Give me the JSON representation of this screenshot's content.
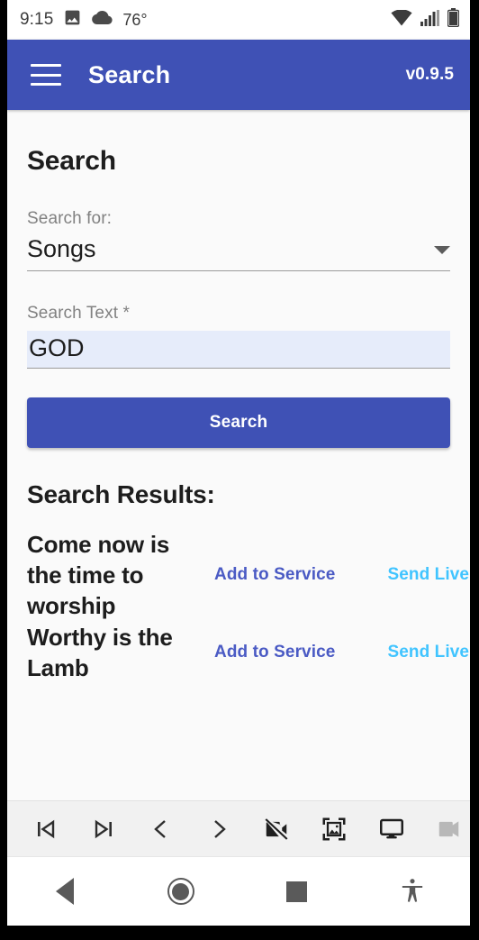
{
  "status_bar": {
    "time": "9:15",
    "temperature": "76°",
    "icons": [
      "image-icon",
      "cloud-icon",
      "wifi-icon",
      "cell-signal-icon",
      "battery-icon"
    ]
  },
  "app_bar": {
    "menu_icon": "hamburger-menu-icon",
    "title": "Search",
    "version": "v0.9.5",
    "background_color": "#3f51b5"
  },
  "main": {
    "page_title": "Search",
    "search_for": {
      "label": "Search for:",
      "value": "Songs",
      "caret_icon": "chevron-down-icon"
    },
    "search_text": {
      "label": "Search Text *",
      "value": "GOD",
      "placeholder": "",
      "highlight_color": "#e6ecfa"
    },
    "search_button": {
      "label": "Search",
      "color": "#3f51b5"
    },
    "results_title": "Search Results:",
    "results": [
      {
        "name": "Come now is the time to worship",
        "add_label": "Add to Service",
        "live_label": "Send Live"
      },
      {
        "name": "Worthy is the Lamb",
        "add_label": "Add to Service",
        "live_label": "Send Live"
      }
    ],
    "action_colors": {
      "add_to_service": "#4a5ac4",
      "send_live": "#40c4ff"
    }
  },
  "media_toolbar": {
    "buttons": [
      {
        "name": "skip-to-first-icon",
        "enabled": true
      },
      {
        "name": "skip-to-last-icon",
        "enabled": true
      },
      {
        "name": "previous-chevron-icon",
        "enabled": true
      },
      {
        "name": "next-chevron-icon",
        "enabled": true
      },
      {
        "name": "videocam-off-icon",
        "enabled": true
      },
      {
        "name": "image-frame-icon",
        "enabled": true
      },
      {
        "name": "desktop-monitor-icon",
        "enabled": true
      },
      {
        "name": "videocam-icon",
        "enabled": false
      }
    ]
  },
  "nav_bar": {
    "buttons": [
      "back-icon",
      "home-icon",
      "recents-icon",
      "accessibility-icon"
    ]
  }
}
